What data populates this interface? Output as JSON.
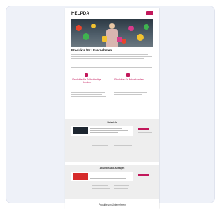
{
  "brand": {
    "name_main": "HELPDA",
    "name_accent": "",
    "accent_color": "#c2185b"
  },
  "hero": {
    "title": "Produkte für Unternehmen"
  },
  "features": [
    {
      "title": "Produkte für Selbständige Kunden"
    },
    {
      "title": "Produkte für Privatkunden"
    }
  ],
  "sections": [
    {
      "title": "Beispiele"
    },
    {
      "title": "Aktuelles und Anfragen"
    }
  ],
  "footer": {
    "title": "Produkte von Unternehmen"
  },
  "icons": {
    "menu": "hamburger-menu-icon",
    "feature": "box-icon"
  }
}
